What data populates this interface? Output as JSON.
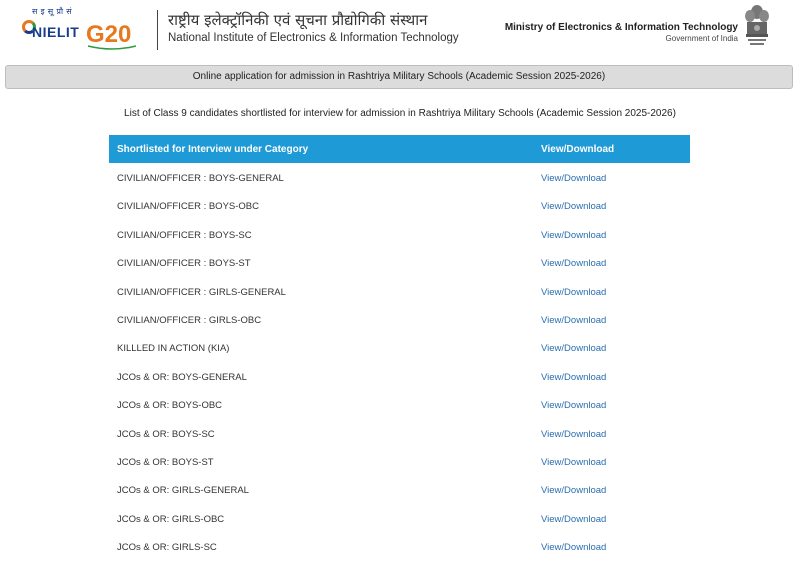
{
  "header": {
    "logo_tagline": "स इ सू प्रौ सं",
    "logo_name": "NIELIT",
    "g20_label": "G20",
    "institute_hindi": "राष्ट्रीय इलेक्ट्रॉनिकी एवं सूचना प्रौद्योगिकी संस्थान",
    "institute_english": "National Institute of Electronics & Information Technology",
    "ministry": "Ministry of Electronics & Information Technology",
    "government": "Government of India"
  },
  "banner": {
    "text": "Online application for admission in Rashtriya Military Schools (Academic Session 2025-2026)"
  },
  "list_title": "List of Class 9 candidates shortlisted for interview for admission in Rashtriya Military Schools (Academic Session 2025-2026)",
  "table": {
    "columns": [
      "Shortlisted for Interview under Category",
      "View/Download"
    ],
    "rows": [
      {
        "category": "CIVILIAN/OFFICER : BOYS-GENERAL",
        "link": "View/Download"
      },
      {
        "category": "CIVILIAN/OFFICER : BOYS-OBC",
        "link": "View/Download"
      },
      {
        "category": "CIVILIAN/OFFICER : BOYS-SC",
        "link": "View/Download"
      },
      {
        "category": "CIVILIAN/OFFICER : BOYS-ST",
        "link": "View/Download"
      },
      {
        "category": "CIVILIAN/OFFICER : GIRLS-GENERAL",
        "link": "View/Download"
      },
      {
        "category": "CIVILIAN/OFFICER : GIRLS-OBC",
        "link": "View/Download"
      },
      {
        "category": "KILLLED IN ACTION (KIA)",
        "link": "View/Download"
      },
      {
        "category": "JCOs & OR: BOYS-GENERAL",
        "link": "View/Download"
      },
      {
        "category": "JCOs & OR: BOYS-OBC",
        "link": "View/Download"
      },
      {
        "category": "JCOs & OR: BOYS-SC",
        "link": "View/Download"
      },
      {
        "category": "JCOs & OR: BOYS-ST",
        "link": "View/Download"
      },
      {
        "category": "JCOs & OR: GIRLS-GENERAL",
        "link": "View/Download"
      },
      {
        "category": "JCOs & OR: GIRLS-OBC",
        "link": "View/Download"
      },
      {
        "category": "JCOs & OR: GIRLS-SC",
        "link": "View/Download"
      }
    ]
  },
  "colors": {
    "table_header_bg": "#1e9ad6",
    "link": "#2a6fb0",
    "banner_bg": "#dcdcdc"
  }
}
